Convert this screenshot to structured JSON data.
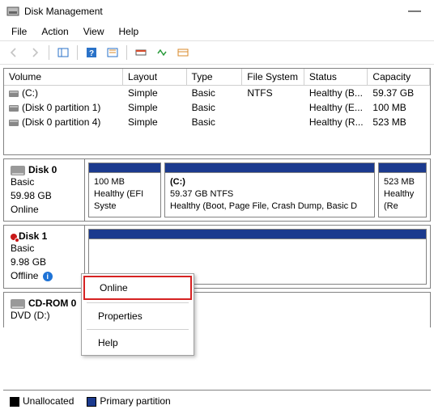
{
  "window": {
    "title": "Disk Management"
  },
  "menu": {
    "file": "File",
    "action": "Action",
    "view": "View",
    "help": "Help"
  },
  "list": {
    "headers": {
      "volume": "Volume",
      "layout": "Layout",
      "type": "Type",
      "fs": "File System",
      "status": "Status",
      "capacity": "Capacity"
    },
    "rows": [
      {
        "volume": "(C:)",
        "layout": "Simple",
        "type": "Basic",
        "fs": "NTFS",
        "status": "Healthy (B...",
        "capacity": "59.37 GB"
      },
      {
        "volume": "(Disk 0 partition 1)",
        "layout": "Simple",
        "type": "Basic",
        "fs": "",
        "status": "Healthy (E...",
        "capacity": "100 MB"
      },
      {
        "volume": "(Disk 0 partition 4)",
        "layout": "Simple",
        "type": "Basic",
        "fs": "",
        "status": "Healthy (R...",
        "capacity": "523 MB"
      }
    ]
  },
  "disks": {
    "disk0": {
      "name": "Disk 0",
      "type": "Basic",
      "size": "59.98 GB",
      "state": "Online",
      "p0": {
        "line1": "100 MB",
        "line2": "Healthy (EFI Syste"
      },
      "p1": {
        "label": "(C:)",
        "line1": "59.37 GB NTFS",
        "line2": "Healthy (Boot, Page File, Crash Dump, Basic D"
      },
      "p2": {
        "line1": "523 MB",
        "line2": "Healthy (Re"
      }
    },
    "disk1": {
      "name": "Disk 1",
      "type": "Basic",
      "size": "9.98 GB",
      "state": "Offline"
    },
    "cdrom": {
      "name": "CD-ROM 0",
      "sub": "DVD (D:)"
    }
  },
  "context_menu": {
    "online": "Online",
    "properties": "Properties",
    "help": "Help"
  },
  "legend": {
    "unallocated": "Unallocated",
    "primary": "Primary partition"
  }
}
